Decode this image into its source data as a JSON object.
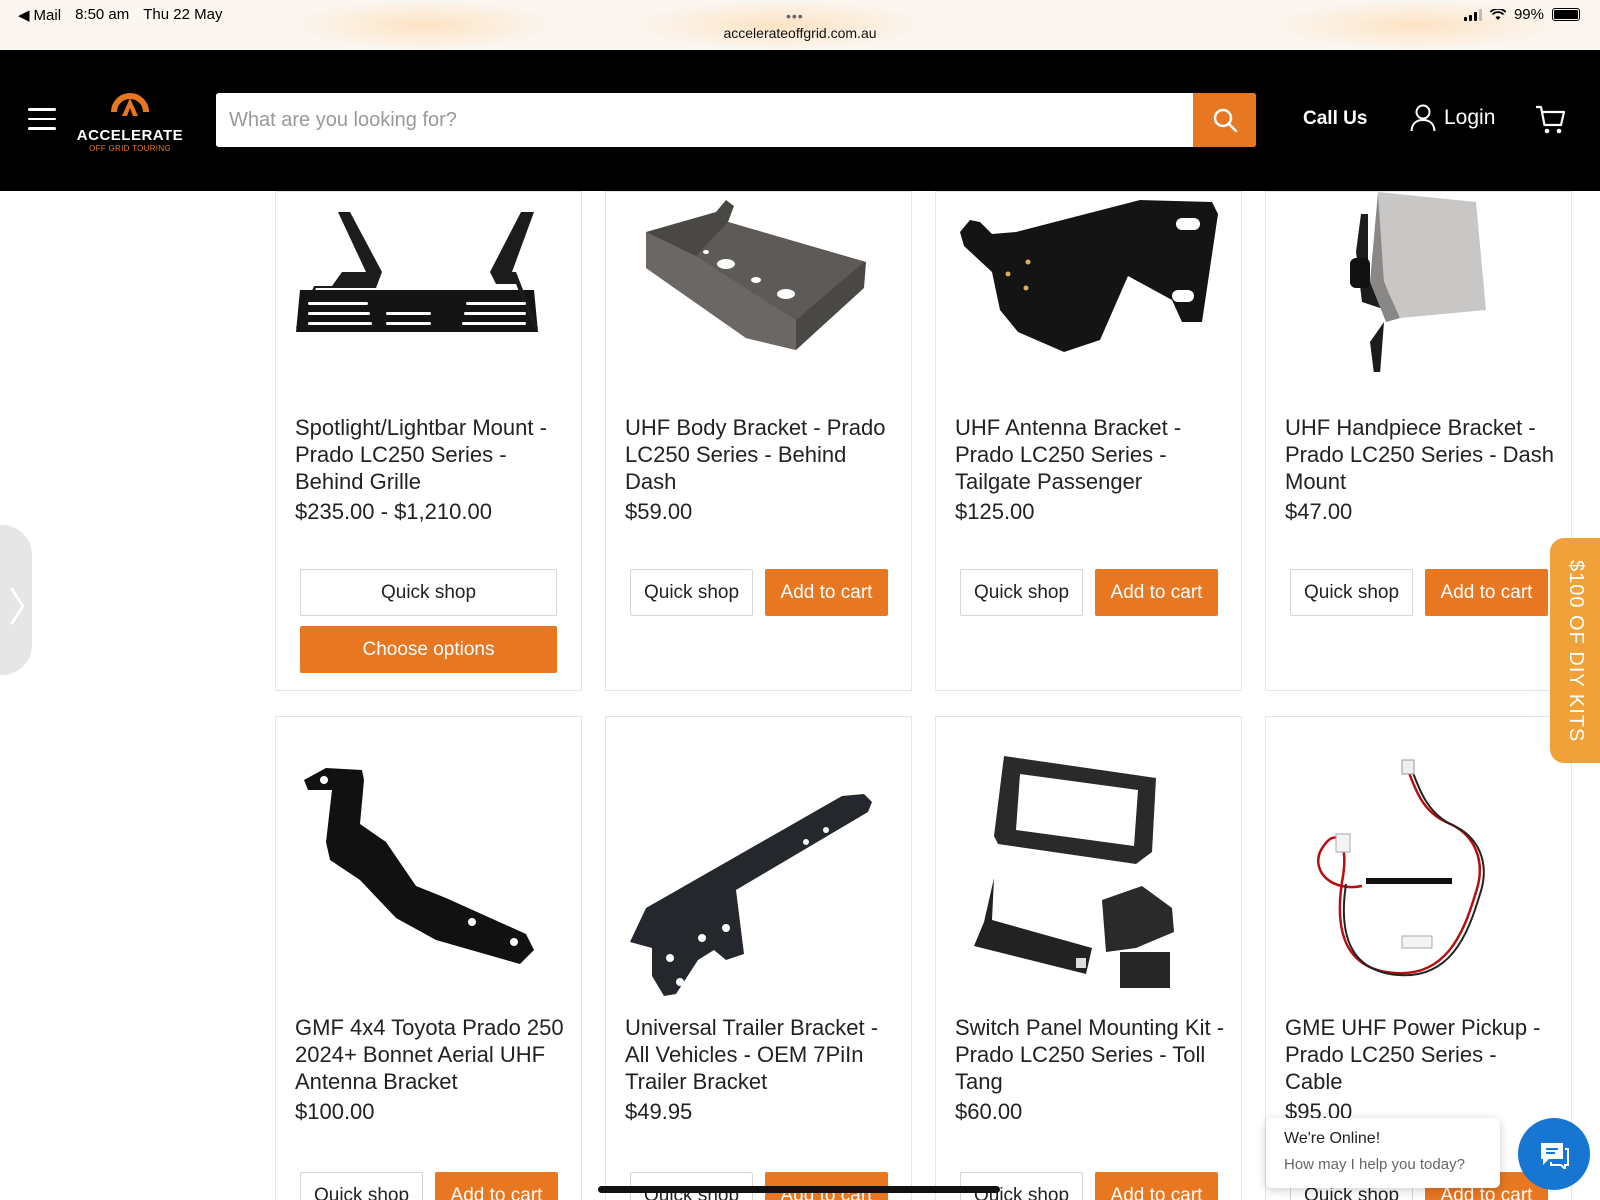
{
  "status_bar": {
    "back_app": "Mail",
    "time": "8:50 am",
    "date": "Thu 22 May",
    "battery": "99%",
    "url": "accelerateoffgrid.com.au"
  },
  "header": {
    "logo_text": "ACCELERATE",
    "logo_subtext": "OFF GRID TOURING",
    "search_placeholder": "What are you looking for?",
    "call_us": "Call Us",
    "login": "Login"
  },
  "colors": {
    "accent": "#e87722",
    "header_bg": "#000000",
    "side_tab": "#f0a13a",
    "chat": "#1676d1"
  },
  "products": [
    {
      "title": "Spotlight/Lightbar Mount - Prado LC250 Series - Behind Grille",
      "price": "$235.00 - $1,210.00",
      "quick_shop": "Quick shop",
      "action": "Choose options"
    },
    {
      "title": "UHF Body Bracket - Prado LC250 Series - Behind Dash",
      "price": "$59.00",
      "quick_shop": "Quick shop",
      "action": "Add to cart"
    },
    {
      "title": "UHF Antenna Bracket - Prado LC250 Series - Tailgate Passenger",
      "price": "$125.00",
      "quick_shop": "Quick shop",
      "action": "Add to cart"
    },
    {
      "title": "UHF Handpiece Bracket - Prado LC250 Series - Dash Mount",
      "price": "$47.00",
      "quick_shop": "Quick shop",
      "action": "Add to cart"
    },
    {
      "title": "GMF 4x4 Toyota Prado 250 2024+ Bonnet Aerial UHF Antenna Bracket",
      "price": "$100.00",
      "quick_shop": "Quick shop",
      "action": "Add to cart"
    },
    {
      "title": "Universal Trailer Bracket - All Vehicles - OEM 7PiIn Trailer Bracket",
      "price": "$49.95",
      "quick_shop": "Quick shop",
      "action": "Add to cart"
    },
    {
      "title": "Switch Panel Mounting Kit - Prado LC250 Series - Toll Tang",
      "price": "$60.00",
      "quick_shop": "Quick shop",
      "action": "Add to cart"
    },
    {
      "title": "GME UHF Power Pickup - Prado LC250 Series - Cable",
      "price": "$95.00",
      "quick_shop": "Quick shop",
      "action": "Add to cart"
    }
  ],
  "side_tab": "$100 OF DIY KITS",
  "chat": {
    "line1": "We're Online!",
    "line2": "How may I help you today?"
  }
}
